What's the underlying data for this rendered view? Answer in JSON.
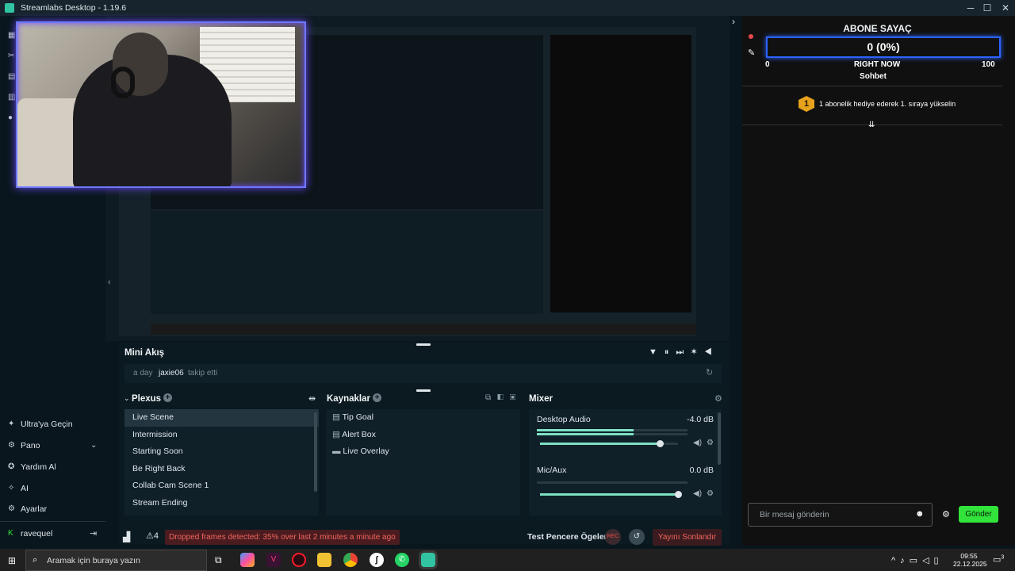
{
  "window": {
    "title": "Streamlabs Desktop - 1.19.6"
  },
  "left_nav": {
    "items": [
      {
        "label": "Ultra'ya Geçin",
        "icon": "ultra-icon"
      },
      {
        "label": "Pano",
        "icon": "dashboard-icon"
      },
      {
        "label": "Yardım Al",
        "icon": "help-icon"
      },
      {
        "label": "AI",
        "icon": "ai-sparkle-icon"
      },
      {
        "label": "Ayarlar",
        "icon": "settings-gear-icon"
      }
    ],
    "user": "ravequel"
  },
  "chat_panel": {
    "counter_title": "ABONE SAYAÇ",
    "counter_value": "0 (0%)",
    "min_label": "0",
    "right_now": "RIGHT NOW",
    "max_label": "100",
    "sohbet": "Sohbet",
    "badge_number": "1",
    "gift_message": "1 abonelik hediye ederek 1. sıraya yükselin",
    "input_placeholder": "Bir mesaj gönderin",
    "send_label": "Gönder"
  },
  "mini_feed": {
    "title": "Mini Akış",
    "event_time": "a day",
    "event_user": "jaxie06",
    "event_action": "takip etti"
  },
  "scenes": {
    "title": "Plexus",
    "items": [
      "Live Scene",
      "Intermission",
      "Starting Soon",
      "Be Right Back",
      "Collab Cam Scene 1",
      "Stream Ending"
    ],
    "selected_index": 0
  },
  "sources": {
    "title": "Kaynaklar",
    "items": [
      {
        "label": "Tip Goal",
        "icon": "file-icon"
      },
      {
        "label": "Alert Box",
        "icon": "file-icon"
      },
      {
        "label": "Live Overlay",
        "icon": "folder-icon"
      }
    ]
  },
  "mixer": {
    "title": "Mixer",
    "channels": [
      {
        "name": "Desktop Audio",
        "level": "-4.0 dB",
        "volume": 0.87
      },
      {
        "name": "Mic/Aux",
        "level": "0.0 dB",
        "volume": 1.0
      }
    ]
  },
  "status_bar": {
    "warning_count": "4",
    "dropped_frames": "Dropped frames detected: 35% over last 2 minutes a minute ago",
    "test_widgets": "Test Pencere Ögeleri",
    "end_stream": "Yayını Sonlandır"
  },
  "taskbar": {
    "search_placeholder": "Aramak için buraya yazın",
    "time": "09:55",
    "date": "22.12.2025",
    "notification_count": "3"
  },
  "colors": {
    "accent": "#31c3a2",
    "send_green": "#31e33b",
    "end_red": "#e64a4a",
    "cam_border": "#6e78ff"
  }
}
